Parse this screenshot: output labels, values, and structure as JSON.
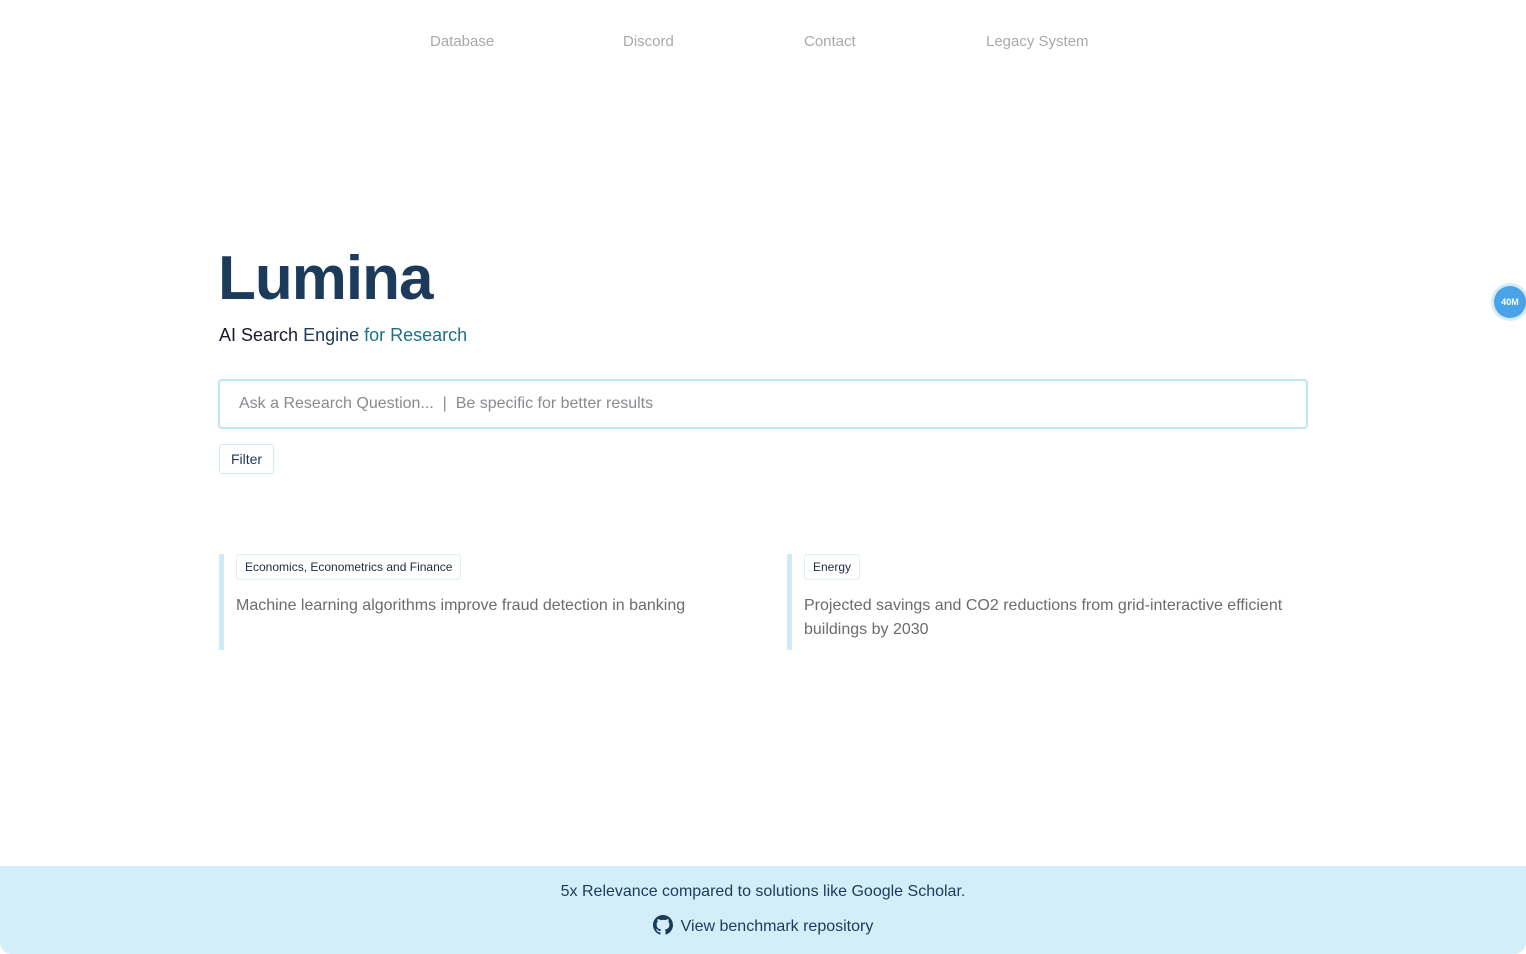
{
  "nav": {
    "items": [
      {
        "label": "Database"
      },
      {
        "label": "Discord"
      },
      {
        "label": "Contact"
      },
      {
        "label": "Legacy System"
      }
    ]
  },
  "hero": {
    "title": "Lumina",
    "subtitle_part1": "AI Search",
    "subtitle_part2": "Engine",
    "subtitle_part3": "for Research"
  },
  "search": {
    "placeholder": "Ask a Research Question...  |  Be specific for better results",
    "value": ""
  },
  "filter": {
    "label": "Filter"
  },
  "examples": [
    {
      "tag": "Economics, Econometrics and Finance",
      "text": "Machine learning algorithms improve fraud detection in banking"
    },
    {
      "tag": "Energy",
      "text": "Projected savings and CO2 reductions from grid-interactive efficient buildings by 2030"
    }
  ],
  "badge": {
    "label": "40M"
  },
  "banner": {
    "text": "5x Relevance compared to solutions like Google Scholar.",
    "link_label": "View benchmark repository",
    "link_icon": "github-icon"
  },
  "colors": {
    "title": "#1c3a5a",
    "accent": "#1d6f8a",
    "banner_bg": "#d3eef8",
    "search_border": "#bfe6f2",
    "badge": "#4aa3e8"
  }
}
